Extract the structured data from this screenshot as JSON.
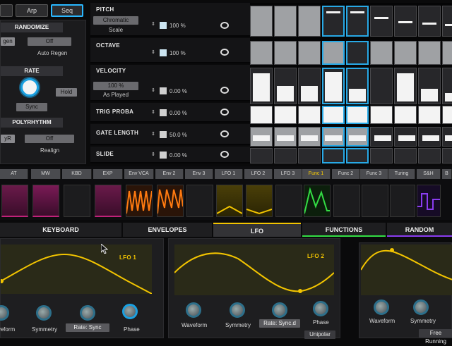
{
  "top_tabs": [
    "Arp",
    "Seq"
  ],
  "left_panel": {
    "randomize": {
      "title": "RANDOMIZE",
      "btn": "gen",
      "dropdown": "Off",
      "label": "Auto Regen"
    },
    "rate": {
      "title": "RATE",
      "hold": "Hold",
      "sync": "Sync"
    },
    "polyrhythm": {
      "title": "POLYRHYTHM",
      "left": "yR",
      "dropdown": "Off",
      "label": "Realign"
    }
  },
  "seq_rows": [
    {
      "name": "PITCH",
      "dropdown": "Chromatic",
      "sub": "Scale",
      "percent": "100 %"
    },
    {
      "name": "OCTAVE",
      "percent": "100 %"
    },
    {
      "name": "VELOCITY",
      "value": "100 %",
      "sub": "As Played",
      "percent": "0.00 %"
    },
    {
      "name": "TRIG PROBA",
      "percent": "0.00 %"
    },
    {
      "name": "GATE LENGTH",
      "percent": "50.0 %"
    },
    {
      "name": "SLIDE",
      "percent": "0.00 %"
    }
  ],
  "mod_tabs": [
    "AT",
    "MW",
    "KBD",
    "EXP",
    "Env VCA",
    "Env 2",
    "Env 3",
    "LFO 1",
    "LFO 2",
    "LFO 3",
    "Func 1",
    "Func 2",
    "Func 3",
    "Turing",
    "S&H",
    "B"
  ],
  "bottom_tabs": [
    "KEYBOARD",
    "ENVELOPES",
    "LFO",
    "FUNCTIONS",
    "RANDOM"
  ],
  "lfo_panels": [
    {
      "title": "LFO 1",
      "knobs": [
        "Waveform",
        "Symmetry",
        "Rate: Sync",
        "Phase"
      ]
    },
    {
      "title": "LFO 2",
      "knobs": [
        "Waveform",
        "Symmetry",
        "Rate: Sync.d",
        "Phase"
      ],
      "extra": "Unipolar"
    },
    {
      "title": "",
      "knobs": [
        "Waveform",
        "Symmetry"
      ],
      "extra": "Free Running"
    }
  ],
  "colors": {
    "accent": "#28a9e6",
    "lfo_yellow": "#f2c400",
    "func_green": "#33dd44",
    "sh_purple": "#8a3cf0",
    "magenta": "#c0227a",
    "orange": "#ff7a10"
  }
}
